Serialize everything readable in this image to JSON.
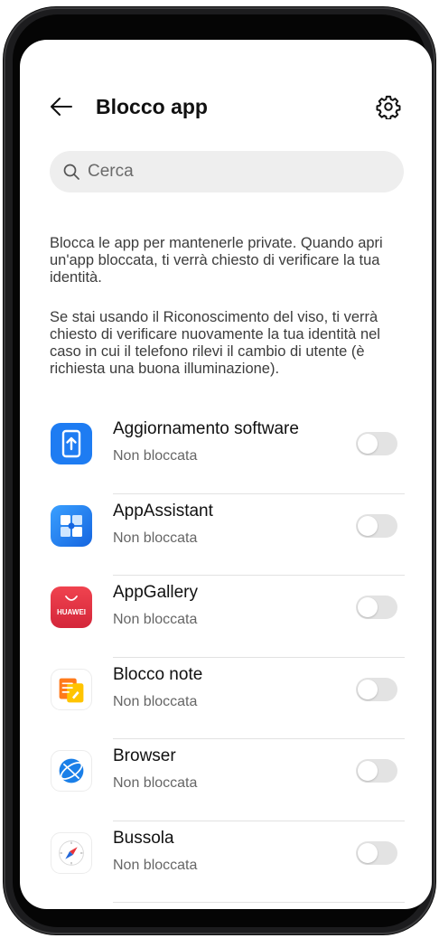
{
  "header": {
    "title": "Blocco app",
    "back_icon": "arrow-left-icon",
    "settings_icon": "gear-icon"
  },
  "search": {
    "placeholder": "Cerca",
    "icon": "search-icon"
  },
  "description": {
    "paragraph1": "Blocca le app per mantenerle private. Quando apri un'app bloccata, ti verrà chiesto di verificare la tua identità.",
    "paragraph2": "Se stai usando il Riconoscimento del viso, ti verrà chiesto di verificare nuovamente la tua identità nel caso in cui il telefono rilevi il cambio di utente (è richiesta una buona illuminazione)."
  },
  "apps": [
    {
      "name": "Aggiornamento software",
      "status": "Non bloccata",
      "locked": false,
      "icon": "software-update-icon"
    },
    {
      "name": "AppAssistant",
      "status": "Non bloccata",
      "locked": false,
      "icon": "appassistant-icon"
    },
    {
      "name": "AppGallery",
      "status": "Non bloccata",
      "locked": false,
      "icon": "appgallery-icon",
      "icon_text": "HUAWEI"
    },
    {
      "name": "Blocco note",
      "status": "Non bloccata",
      "locked": false,
      "icon": "notepad-icon"
    },
    {
      "name": "Browser",
      "status": "Non bloccata",
      "locked": false,
      "icon": "browser-icon"
    },
    {
      "name": "Bussola",
      "status": "Non bloccata",
      "locked": false,
      "icon": "compass-icon"
    }
  ],
  "colors": {
    "toggle_off": "#e3e3e3",
    "update_blue": "#1e7cf2",
    "appgallery_red": "#e83344",
    "notepad_orange": "#ff9a1f",
    "browser_blue": "#1a7fe8"
  }
}
